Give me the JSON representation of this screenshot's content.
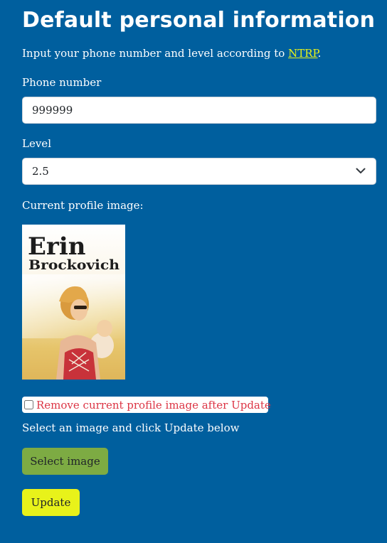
{
  "page": {
    "title": "Default personal information",
    "intro_prefix": "Input your phone number and level according to ",
    "intro_link": "NTRP",
    "intro_suffix": "."
  },
  "phone": {
    "label": "Phone number",
    "value": "999999"
  },
  "level": {
    "label": "Level",
    "selected": "2.5"
  },
  "profile_image": {
    "label": "Current profile image:",
    "poster_line1": "Erin",
    "poster_line2": "Brockovich"
  },
  "remove_option": {
    "label": "Remove current profile image after Update",
    "checked": false
  },
  "upload": {
    "instruction": "Select an image and click Update below",
    "select_button": "Select image",
    "update_button": "Update"
  },
  "colors": {
    "background": "#005f9e",
    "link": "#e8f21a",
    "select_button": "#7dab43",
    "update_button": "#e8f21a",
    "remove_text": "#dc3545"
  },
  "icons": {
    "level_dropdown": "chevron-down-icon"
  }
}
